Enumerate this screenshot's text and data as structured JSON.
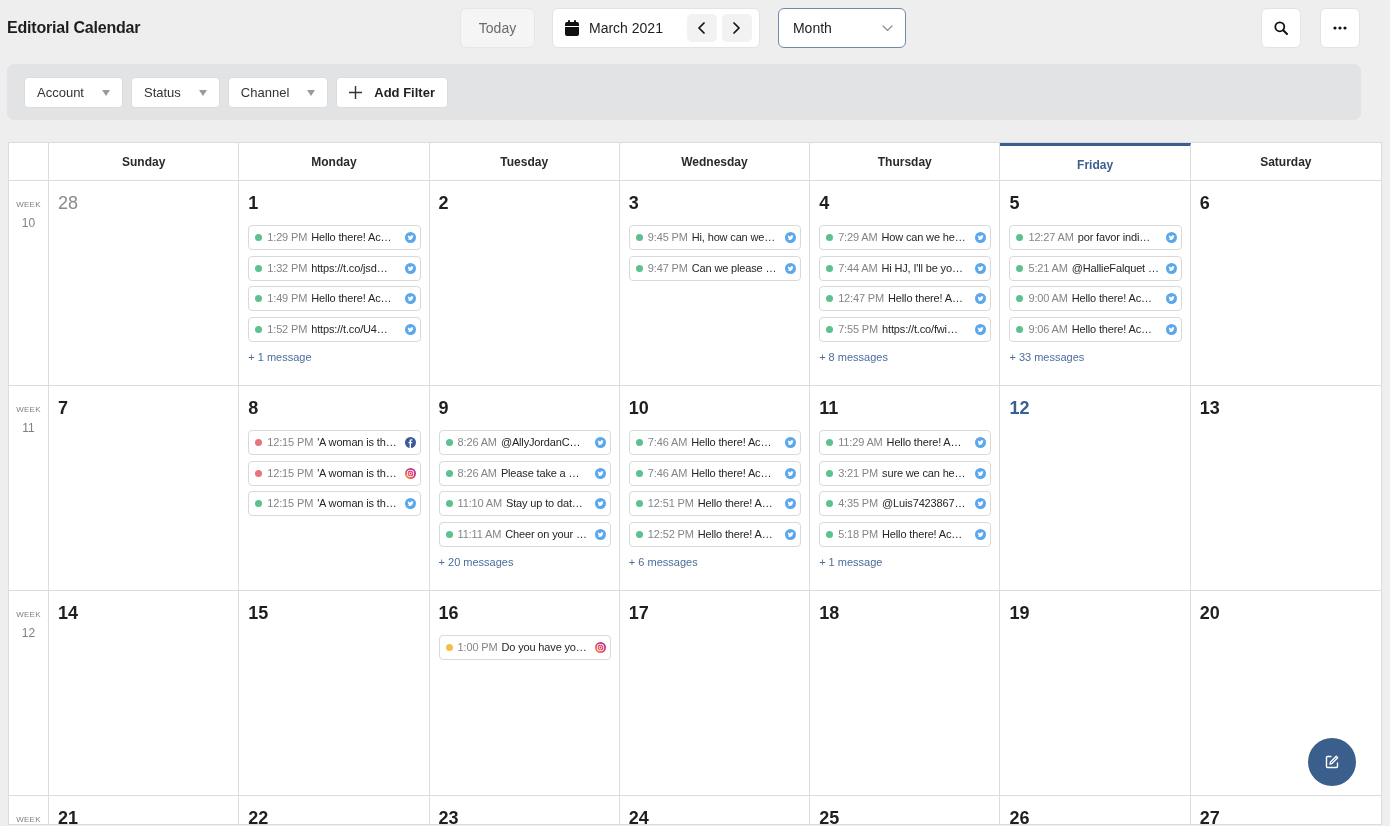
{
  "header": {
    "title": "Editorial Calendar",
    "today_button": "Today",
    "month_label": "March 2021",
    "view_select": {
      "value": "Month"
    }
  },
  "filters": [
    {
      "label": "Account",
      "kind": "dropdown"
    },
    {
      "label": "Status",
      "kind": "dropdown"
    },
    {
      "label": "Channel",
      "kind": "dropdown"
    },
    {
      "label": "Add Filter",
      "kind": "add"
    }
  ],
  "calendar": {
    "weekdays": [
      {
        "label": "Sunday",
        "today": false
      },
      {
        "label": "Monday",
        "today": false
      },
      {
        "label": "Tuesday",
        "today": false
      },
      {
        "label": "Wednesday",
        "today": false
      },
      {
        "label": "Thursday",
        "today": false
      },
      {
        "label": "Friday",
        "today": true
      },
      {
        "label": "Saturday",
        "today": false
      }
    ],
    "weeks": [
      {
        "week_label": "WEEK",
        "week_number": "10",
        "days": [
          {
            "number": "28",
            "outside_month": true,
            "today": false
          },
          {
            "number": "1",
            "outside_month": false,
            "today": false,
            "messages": [
              {
                "time": "1:29 PM",
                "text": "Hello there! Ac…",
                "color": "#5cc08f",
                "kind": "bird"
              },
              {
                "time": "1:32 PM",
                "text": "https://t.co/jsd…",
                "color": "#5cc08f",
                "kind": "bird"
              },
              {
                "time": "1:49 PM",
                "text": "Hello there! Ac…",
                "color": "#5cc08f",
                "kind": "bird"
              },
              {
                "time": "1:52 PM",
                "text": "https://t.co/U4…",
                "color": "#5cc08f",
                "kind": "bird"
              }
            ],
            "more": "+ 1 message"
          },
          {
            "number": "2",
            "outside_month": false,
            "today": false
          },
          {
            "number": "3",
            "outside_month": false,
            "today": false,
            "messages": [
              {
                "time": "9:45 PM",
                "text": "Hi, how can we…",
                "color": "#5cc08f",
                "kind": "bird"
              },
              {
                "time": "9:47 PM",
                "text": "Can we please …",
                "color": "#5cc08f",
                "kind": "bird"
              }
            ]
          },
          {
            "number": "4",
            "outside_month": false,
            "today": false,
            "messages": [
              {
                "time": "7:29 AM",
                "text": "How can we he…",
                "color": "#5cc08f",
                "kind": "bird"
              },
              {
                "time": "7:44 AM",
                "text": "Hi HJ, I'll be yo…",
                "color": "#5cc08f",
                "kind": "bird"
              },
              {
                "time": "12:47 PM",
                "text": "Hello there! A…",
                "color": "#5cc08f",
                "kind": "bird"
              },
              {
                "time": "7:55 PM",
                "text": "https://t.co/fwi…",
                "color": "#5cc08f",
                "kind": "bird"
              }
            ],
            "more": "+ 8 messages"
          },
          {
            "number": "5",
            "outside_month": false,
            "today": false,
            "messages": [
              {
                "time": "12:27 AM",
                "text": "por favor indi…",
                "color": "#5cc08f",
                "kind": "bird"
              },
              {
                "time": "5:21 AM",
                "text": "@HallieFalquet …",
                "color": "#5cc08f",
                "kind": "bird"
              },
              {
                "time": "9:00 AM",
                "text": "Hello there! Ac…",
                "color": "#5cc08f",
                "kind": "bird"
              },
              {
                "time": "9:06 AM",
                "text": "Hello there! Ac…",
                "color": "#5cc08f",
                "kind": "bird"
              }
            ],
            "more": "+ 33 messages"
          },
          {
            "number": "6",
            "outside_month": false,
            "today": false
          }
        ]
      },
      {
        "week_label": "WEEK",
        "week_number": "11",
        "days": [
          {
            "number": "7",
            "outside_month": false,
            "today": false
          },
          {
            "number": "8",
            "outside_month": false,
            "today": false,
            "messages": [
              {
                "time": "12:15 PM",
                "text": "'A woman is th…",
                "color": "#e8737a",
                "kind": "letterf"
              },
              {
                "time": "12:15 PM",
                "text": "'A woman is th…",
                "color": "#e8737a",
                "kind": "camera"
              },
              {
                "time": "12:15 PM",
                "text": "'A woman is th…",
                "color": "#5cc08f",
                "kind": "bird"
              }
            ]
          },
          {
            "number": "9",
            "outside_month": false,
            "today": false,
            "messages": [
              {
                "time": "8:26 AM",
                "text": "@AllyJordanC…",
                "color": "#5cc08f",
                "kind": "bird"
              },
              {
                "time": "8:26 AM",
                "text": "Please take a …",
                "color": "#5cc08f",
                "kind": "bird"
              },
              {
                "time": "11:10 AM",
                "text": "Stay up to dat…",
                "color": "#5cc08f",
                "kind": "bird"
              },
              {
                "time": "11:11 AM",
                "text": "Cheer on your …",
                "color": "#5cc08f",
                "kind": "bird"
              }
            ],
            "more": "+ 20 messages"
          },
          {
            "number": "10",
            "outside_month": false,
            "today": false,
            "messages": [
              {
                "time": "7:46 AM",
                "text": "Hello there! Ac…",
                "color": "#5cc08f",
                "kind": "bird"
              },
              {
                "time": "7:46 AM",
                "text": "Hello there! Ac…",
                "color": "#5cc08f",
                "kind": "bird"
              },
              {
                "time": "12:51 PM",
                "text": "Hello there! A…",
                "color": "#5cc08f",
                "kind": "bird"
              },
              {
                "time": "12:52 PM",
                "text": "Hello there! A…",
                "color": "#5cc08f",
                "kind": "bird"
              }
            ],
            "more": "+ 6 messages"
          },
          {
            "number": "11",
            "outside_month": false,
            "today": false,
            "messages": [
              {
                "time": "11:29 AM",
                "text": "Hello there! A…",
                "color": "#5cc08f",
                "kind": "bird"
              },
              {
                "time": "3:21 PM",
                "text": "sure we can he…",
                "color": "#5cc08f",
                "kind": "bird"
              },
              {
                "time": "4:35 PM",
                "text": "@Luis7423867…",
                "color": "#5cc08f",
                "kind": "bird"
              },
              {
                "time": "5:18 PM",
                "text": "Hello there! Ac…",
                "color": "#5cc08f",
                "kind": "bird"
              }
            ],
            "more": "+ 1 message"
          },
          {
            "number": "12",
            "outside_month": false,
            "today": true
          },
          {
            "number": "13",
            "outside_month": false,
            "today": false
          }
        ]
      },
      {
        "week_label": "WEEK",
        "week_number": "12",
        "days": [
          {
            "number": "14",
            "outside_month": false,
            "today": false
          },
          {
            "number": "15",
            "outside_month": false,
            "today": false
          },
          {
            "number": "16",
            "outside_month": false,
            "today": false,
            "messages": [
              {
                "time": "1:00 PM",
                "text": "Do you have yo…",
                "color": "#f2bf4a",
                "kind": "camera"
              }
            ]
          },
          {
            "number": "17",
            "outside_month": false,
            "today": false
          },
          {
            "number": "18",
            "outside_month": false,
            "today": false
          },
          {
            "number": "19",
            "outside_month": false,
            "today": false
          },
          {
            "number": "20",
            "outside_month": false,
            "today": false
          }
        ]
      },
      {
        "week_label": "WEEK",
        "days": [
          {
            "number": "21",
            "outside_month": false,
            "today": false
          },
          {
            "number": "22",
            "outside_month": false,
            "today": false
          },
          {
            "number": "23",
            "outside_month": false,
            "today": false
          },
          {
            "number": "24",
            "outside_month": false,
            "today": false
          },
          {
            "number": "25",
            "outside_month": false,
            "today": false
          },
          {
            "number": "26",
            "outside_month": false,
            "today": false
          },
          {
            "number": "27",
            "outside_month": false,
            "today": false
          }
        ]
      }
    ]
  }
}
